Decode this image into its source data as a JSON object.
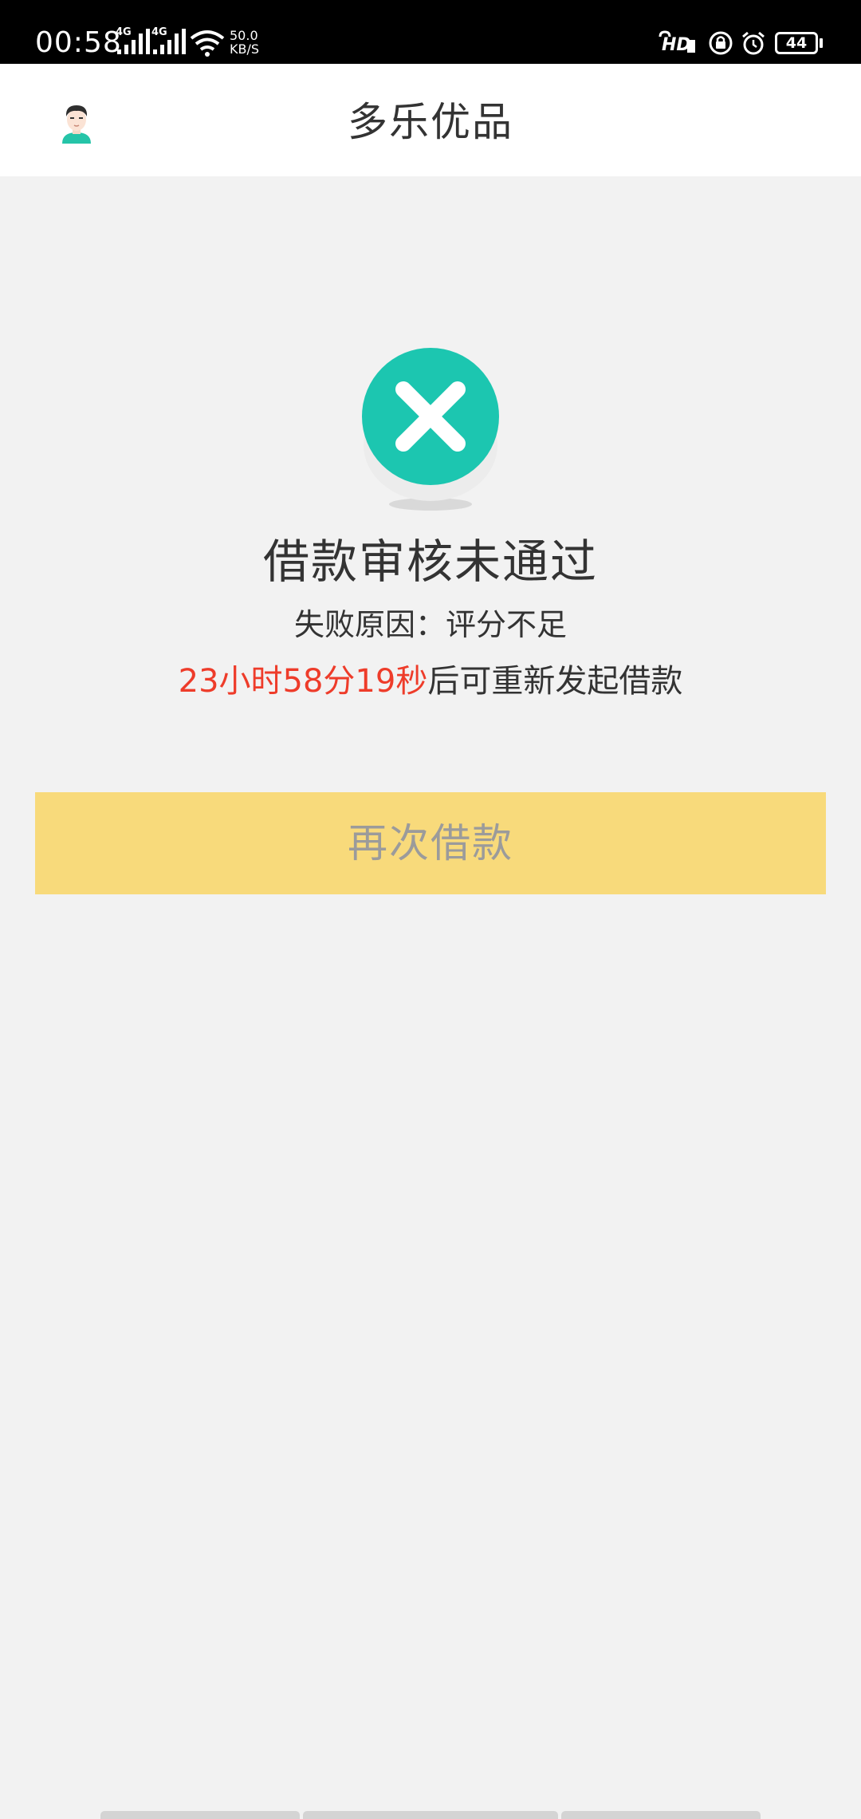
{
  "status_bar": {
    "time": "00:58",
    "signal_1_label": "4G",
    "signal_2_label": "4G",
    "net_speed_value": "50.0",
    "net_speed_unit": "KB/S",
    "hd_label": "HD",
    "battery_level": "44",
    "icons": [
      "signal-icon",
      "wifi-icon",
      "hd-call-icon",
      "lock-icon",
      "alarm-icon",
      "battery-icon"
    ]
  },
  "app_bar": {
    "title": "多乐优品",
    "avatar_icon": "user-avatar-icon"
  },
  "result": {
    "icon": "close-circle-icon",
    "icon_color": "#1cc6b0",
    "title": "借款审核未通过",
    "reason": "失败原因：评分不足",
    "countdown_time": "23小时58分19秒",
    "countdown_suffix": "后可重新发起借款",
    "countdown_color": "#ee3c2a"
  },
  "actions": {
    "retry_label": "再次借款",
    "retry_color": "#f8da7b"
  }
}
